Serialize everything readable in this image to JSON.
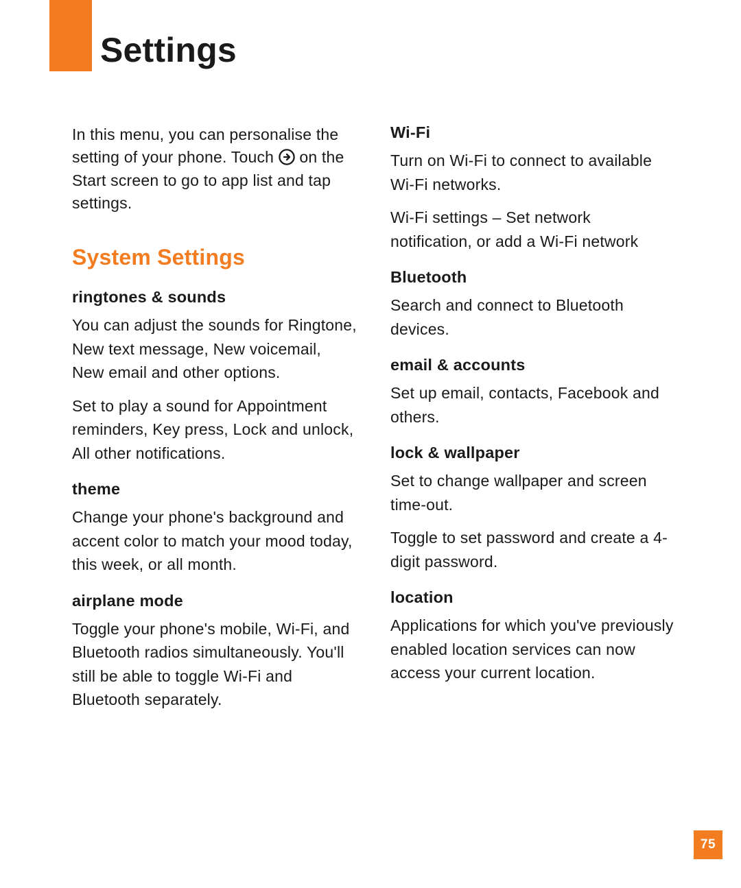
{
  "colors": {
    "accent": "#f47c20"
  },
  "page_title": "Settings",
  "page_number": "75",
  "intro": {
    "text_before_icon": "In this menu, you can personalise the setting of your phone. Touch ",
    "icon_name": "arrow-right-circle-icon",
    "text_after_icon": " on the Start screen to go to app list and tap settings."
  },
  "section_heading": "System Settings",
  "left_column": [
    {
      "heading": "ringtones & sounds",
      "paragraphs": [
        "You can adjust the sounds for Ringtone, New text message, New voicemail, New email and other options.",
        "Set to play a sound for Appointment reminders, Key press, Lock and unlock, All other notifications."
      ]
    },
    {
      "heading": "theme",
      "paragraphs": [
        "Change your phone's background and accent color to match your mood today, this week, or all month."
      ]
    },
    {
      "heading": "airplane mode",
      "paragraphs": [
        "Toggle your phone's mobile, Wi-Fi, and Bluetooth radios simultaneously. You'll still be able to toggle Wi-Fi and Bluetooth separately."
      ]
    }
  ],
  "right_column": [
    {
      "heading": "Wi-Fi",
      "paragraphs": [
        "Turn on Wi-Fi to connect to available Wi-Fi networks.",
        "Wi-Fi settings – Set network notification, or add a Wi-Fi network"
      ]
    },
    {
      "heading": "Bluetooth",
      "paragraphs": [
        "Search and connect to Bluetooth devices."
      ]
    },
    {
      "heading": "email & accounts",
      "paragraphs": [
        "Set up email, contacts, Facebook and others."
      ]
    },
    {
      "heading": "lock & wallpaper",
      "paragraphs": [
        "Set to change wallpaper and screen time-out.",
        "Toggle to set password and create a 4-digit password."
      ]
    },
    {
      "heading": "location",
      "paragraphs": [
        "Applications for which you've previously enabled location services can now access your current location."
      ]
    }
  ]
}
